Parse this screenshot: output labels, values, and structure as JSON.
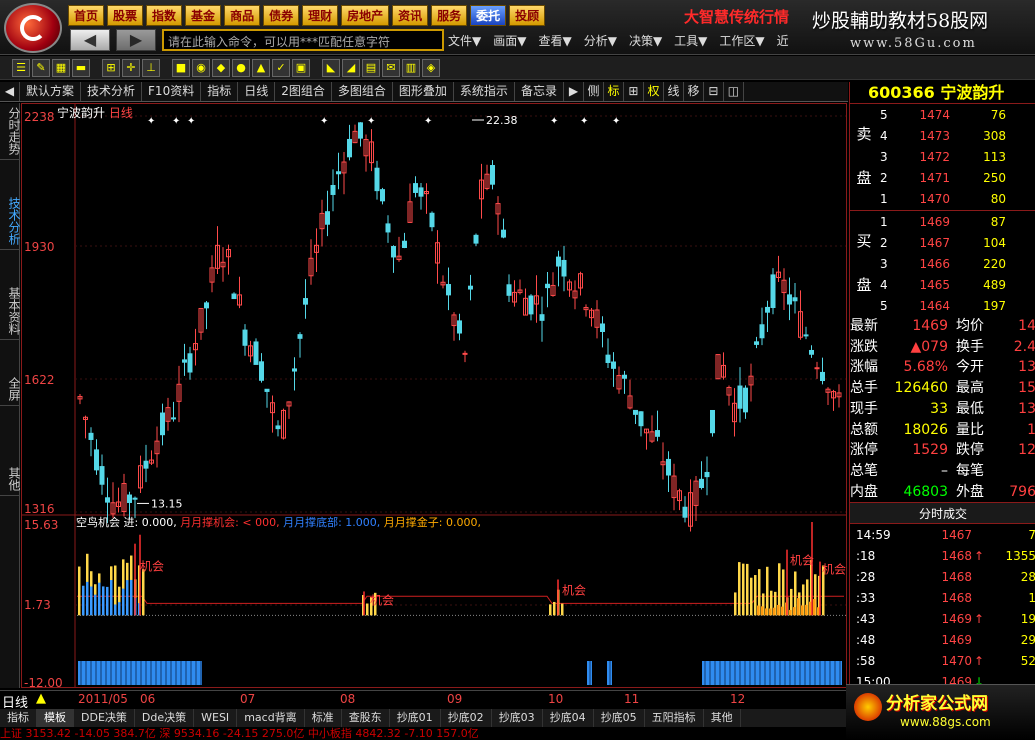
{
  "nav_buttons": [
    "首页",
    "股票",
    "指数",
    "基金",
    "商品",
    "债券",
    "理财",
    "房地产",
    "资讯",
    "服务",
    "委托",
    "投顾"
  ],
  "brand": "大智慧传统行情",
  "watermark": {
    "top": "炒股輔助教材58股网",
    "bottom": "www.58Gu.com"
  },
  "command_input": {
    "value": "请在此输入命令，可以用***匹配任意字符"
  },
  "menu": [
    "文件▼",
    "画面▼",
    "查看▼",
    "分析▼",
    "决策▼",
    "工具▼",
    "工作区▼",
    "近"
  ],
  "chart_tabs": [
    "默认方案",
    "技术分析",
    "F10资料",
    "指标",
    "日线",
    "2图组合",
    "多图组合",
    "图形叠加",
    "系统指示",
    "备忘录"
  ],
  "chart_side_tabs": [
    "侧",
    "标",
    "⊞",
    "权",
    "线",
    "移",
    "⊟",
    "◫"
  ],
  "left_tabs": [
    {
      "label": "分时走势",
      "active": false
    },
    {
      "label": "技术分析",
      "active": true
    },
    {
      "label": "基本资料",
      "active": false
    },
    {
      "label": "全屏",
      "active": false
    },
    {
      "label": "其他",
      "active": false
    }
  ],
  "stock": {
    "code": "600366",
    "name": "宁波韵升",
    "chart_title": "宁波韵升",
    "period": "日线"
  },
  "price_axis": [
    "2238",
    "1930",
    "1622",
    "1316"
  ],
  "indicator_axis": [
    "15.63",
    "1.73",
    "-12.00"
  ],
  "chart_annotations": {
    "high": "22.38",
    "low": "13.15"
  },
  "indicator_legend": {
    "name": "空鸟机会",
    "items": [
      {
        "label": "进: 0.000,",
        "color": "#ffffff"
      },
      {
        "label": "月月撑机会: < 000,",
        "color": "#ff3030"
      },
      {
        "label": "月月撑底部: 1.000,",
        "color": "#3080ff"
      },
      {
        "label": "月月撑金子: 0.000,",
        "color": "#ffaa00"
      }
    ],
    "signal_label": "机会"
  },
  "chart_data": {
    "type": "candlestick",
    "y_range": [
      13.16,
      22.38
    ],
    "dates": [
      "2011/05",
      "06",
      "07",
      "08",
      "09",
      "10",
      "11",
      "12"
    ],
    "candles_shape": "daily OHLC approximated from image",
    "indicator_range": [
      -12.0,
      15.63
    ]
  },
  "period_label": "日线",
  "bottom_tabs": [
    "指标",
    "模板",
    "DDE决策",
    "Dde决策",
    "WESI",
    "macd背离",
    "标准",
    "查股东",
    "抄底01",
    "抄底02",
    "抄底03",
    "抄底04",
    "抄底05",
    "五阳指标",
    "其他"
  ],
  "status_text": "上证 3153.42 -14.05 384.7亿 深 9534.16 -24.15 275.0亿 中小板指 4842.32 -7.10 157.0亿",
  "order_book": {
    "sell": [
      {
        "lvl": "5",
        "price": "1474",
        "vol": "76"
      },
      {
        "lvl": "4",
        "price": "1473",
        "vol": "308"
      },
      {
        "lvl": "3",
        "price": "1472",
        "vol": "113"
      },
      {
        "lvl": "2",
        "price": "1471",
        "vol": "250"
      },
      {
        "lvl": "1",
        "price": "1470",
        "vol": "80"
      }
    ],
    "buy": [
      {
        "lvl": "1",
        "price": "1469",
        "vol": "87"
      },
      {
        "lvl": "2",
        "price": "1467",
        "vol": "104"
      },
      {
        "lvl": "3",
        "price": "1466",
        "vol": "220"
      },
      {
        "lvl": "4",
        "price": "1465",
        "vol": "489"
      },
      {
        "lvl": "5",
        "price": "1464",
        "vol": "197"
      }
    ],
    "sell_label": [
      "卖",
      "盘"
    ],
    "buy_label": [
      "买",
      "盘"
    ]
  },
  "quote": [
    {
      "k1": "最新",
      "v1": "1469",
      "c1": "#ff4040",
      "k2": "均价",
      "v2": "14"
    },
    {
      "k1": "涨跌",
      "v1": "▲079",
      "c1": "#ff4040",
      "k2": "换手",
      "v2": "2.4"
    },
    {
      "k1": "涨幅",
      "v1": "5.68%",
      "c1": "#ff4040",
      "k2": "今开",
      "v2": "13"
    },
    {
      "k1": "总手",
      "v1": "126460",
      "c1": "#ffff00",
      "k2": "最高",
      "v2": "15"
    },
    {
      "k1": "现手",
      "v1": "33",
      "c1": "#ffff00",
      "k2": "最低",
      "v2": "13"
    },
    {
      "k1": "总额",
      "v1": "18026",
      "c1": "#ffff00",
      "k2": "量比",
      "v2": "1"
    },
    {
      "k1": "涨停",
      "v1": "1529",
      "c1": "#ff4040",
      "k2": "跌停",
      "v2": "12"
    },
    {
      "k1": "总笔",
      "v1": "–",
      "c1": "#ffffff",
      "k2": "每笔",
      "v2": ""
    },
    {
      "k1": "内盘",
      "v1": "46803",
      "c1": "#00ff00",
      "k2": "外盘",
      "v2": "796"
    }
  ],
  "ticks_title": "分时成交",
  "ticks": [
    {
      "t": "14:59",
      "p": "1467",
      "a": "",
      "v": "7"
    },
    {
      "t": ":18",
      "p": "1468",
      "a": "↑",
      "v": "1355"
    },
    {
      "t": ":28",
      "p": "1468",
      "a": "",
      "v": "28"
    },
    {
      "t": ":33",
      "p": "1468",
      "a": "",
      "v": "1"
    },
    {
      "t": ":43",
      "p": "1469",
      "a": "↑",
      "v": "19"
    },
    {
      "t": ":48",
      "p": "1469",
      "a": "",
      "v": "29"
    },
    {
      "t": ":58",
      "p": "1470",
      "a": "↑",
      "v": "52"
    },
    {
      "t": "15:00",
      "p": "1469",
      "a": "↓",
      "v": ""
    }
  ],
  "ad": {
    "title": "分析家公式网",
    "url": "www.88gs.com"
  }
}
